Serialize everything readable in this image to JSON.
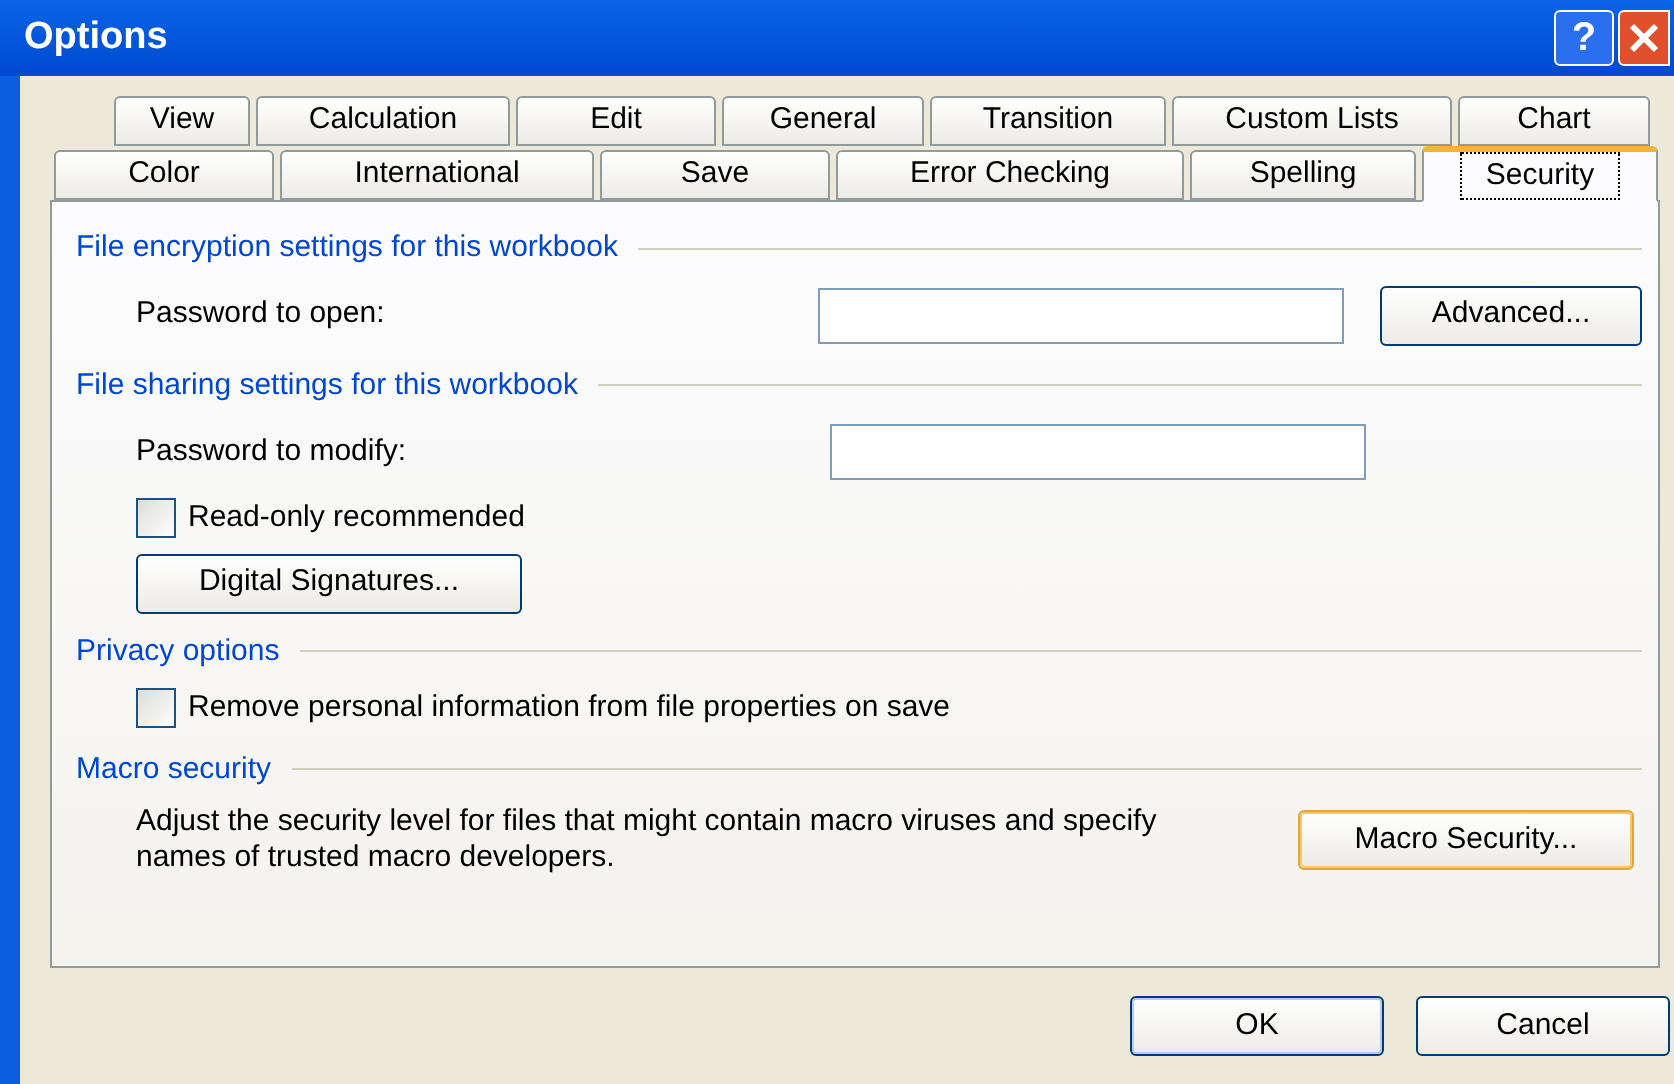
{
  "window": {
    "title": "Options",
    "help_glyph": "?"
  },
  "tab_rows": [
    [
      {
        "label": "View",
        "selected": false
      },
      {
        "label": "Calculation",
        "selected": false
      },
      {
        "label": "Edit",
        "selected": false
      },
      {
        "label": "General",
        "selected": false
      },
      {
        "label": "Transition",
        "selected": false
      },
      {
        "label": "Custom Lists",
        "selected": false
      },
      {
        "label": "Chart",
        "selected": false
      }
    ],
    [
      {
        "label": "Color",
        "selected": false
      },
      {
        "label": "International",
        "selected": false
      },
      {
        "label": "Save",
        "selected": false
      },
      {
        "label": "Error Checking",
        "selected": false
      },
      {
        "label": "Spelling",
        "selected": false
      },
      {
        "label": "Security",
        "selected": true
      }
    ]
  ],
  "sections": [
    {
      "title": "File encryption settings for this workbook",
      "items": [
        {
          "kind": "password",
          "label": "Password to open:",
          "button": "Advanced..."
        }
      ]
    },
    {
      "title": "File sharing settings for this workbook",
      "items": [
        {
          "kind": "password",
          "label": "Password to modify:"
        },
        {
          "kind": "checkbox",
          "label": "Read-only recommended",
          "checked": false
        },
        {
          "kind": "button",
          "label": "Digital Signatures..."
        }
      ]
    },
    {
      "title": "Privacy options",
      "items": [
        {
          "kind": "checkbox",
          "label": "Remove personal information from file properties on save",
          "checked": false
        }
      ]
    },
    {
      "title": "Macro security",
      "items": [
        {
          "kind": "text",
          "label": "Adjust the security level for files that might contain macro viruses and specify names of trusted macro developers.",
          "button": "Macro Security...",
          "focused": true
        }
      ]
    }
  ],
  "buttons": [
    {
      "label": "OK",
      "default": true
    },
    {
      "label": "Cancel",
      "default": false
    }
  ]
}
